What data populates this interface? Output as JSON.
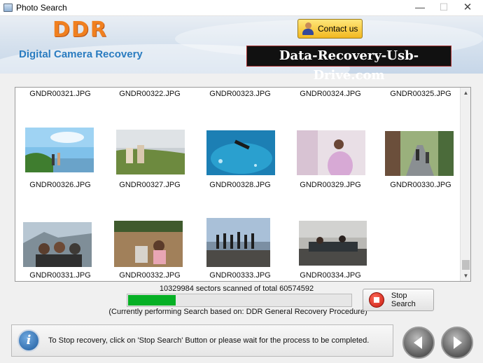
{
  "window": {
    "title": "Photo Search",
    "minimize": "—",
    "maximize": "☐",
    "close": "✕"
  },
  "header": {
    "brand": "DDR",
    "subtitle": "Digital Camera Recovery",
    "contact_label": "Contact us",
    "website": "Data-Recovery-Usb-Drive.com"
  },
  "thumbnails": {
    "top_row": [
      "GNDR00321.JPG",
      "GNDR00322.JPG",
      "GNDR00323.JPG",
      "GNDR00324.JPG",
      "GNDR00325.JPG"
    ],
    "row2": [
      "GNDR00326.JPG",
      "GNDR00327.JPG",
      "GNDR00328.JPG",
      "GNDR00329.JPG",
      "GNDR00330.JPG"
    ],
    "row3": [
      "GNDR00331.JPG",
      "GNDR00332.JPG",
      "GNDR00333.JPG",
      "GNDR00334.JPG"
    ]
  },
  "scan": {
    "status": "10329984 sectors scanned of total 60574592",
    "progress_fraction": 0.1705,
    "procedure": "(Currently performing Search based on:  DDR General Recovery Procedure)",
    "stop_label": "Stop Search"
  },
  "footer": {
    "info_icon": "i",
    "message": "To Stop recovery, click on 'Stop Search' Button or please wait for the process to be completed."
  },
  "colors": {
    "progress": "#06b025",
    "brand": "#f08020",
    "subtitle": "#2a7cc0"
  }
}
